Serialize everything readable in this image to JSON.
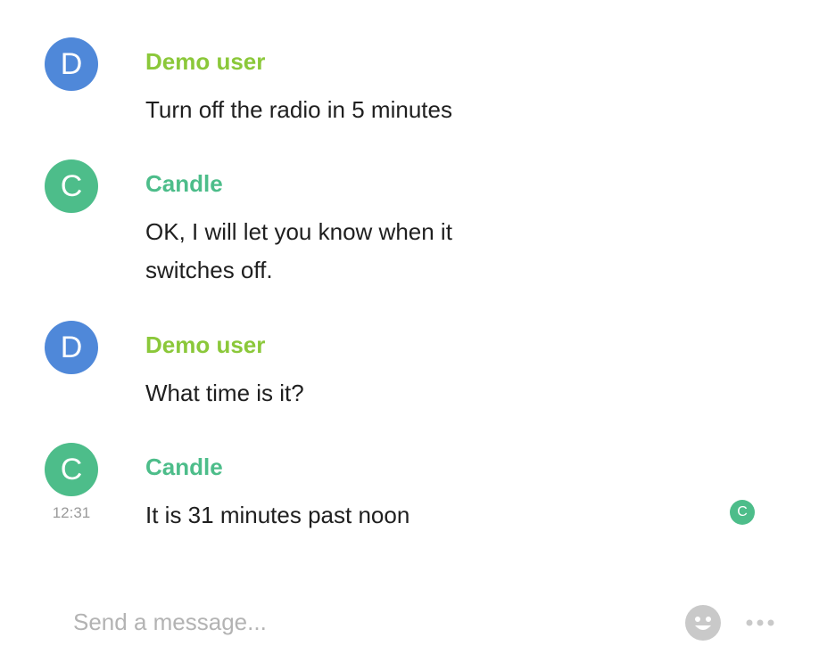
{
  "messages": [
    {
      "sender": "Demo user",
      "avatar_initial": "D",
      "text": "Turn off the radio in 5 minutes",
      "avatar_color": "#4f88d9",
      "name_color": "#8bc83a"
    },
    {
      "sender": "Candle",
      "avatar_initial": "C",
      "text": "OK, I will let you know when it switches off.",
      "avatar_color": "#4dbd8a",
      "name_color": "#4dbd8a"
    },
    {
      "sender": "Demo user",
      "avatar_initial": "D",
      "text": "What time is it?",
      "avatar_color": "#4f88d9",
      "name_color": "#8bc83a"
    },
    {
      "sender": "Candle",
      "avatar_initial": "C",
      "text": "It is 31 minutes past noon",
      "timestamp": "12:31",
      "read_receipt_initial": "C",
      "avatar_color": "#4dbd8a",
      "name_color": "#4dbd8a"
    }
  ],
  "composer": {
    "placeholder": "Send a message...",
    "emoji_icon": "smiley-face-icon",
    "more_icon": "more-horizontal-icon"
  }
}
